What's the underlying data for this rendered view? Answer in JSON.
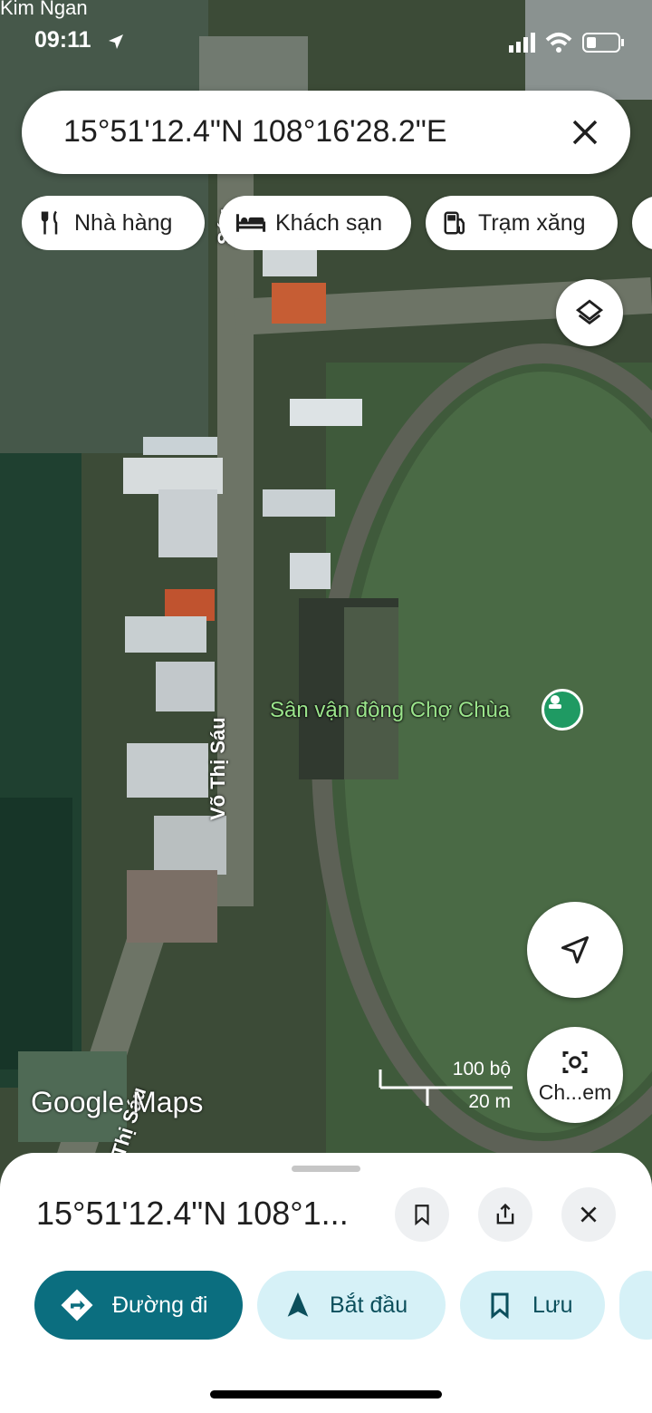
{
  "status_bar": {
    "carrier": "Kim Ngan",
    "time": "09:11"
  },
  "search": {
    "query": "15°51'12.4\"N 108°16'28.2\"E"
  },
  "chips": [
    {
      "label": "Nhà hàng",
      "icon": "restaurant-icon"
    },
    {
      "label": "Khách sạn",
      "icon": "hotel-icon"
    },
    {
      "label": "Trạm xăng",
      "icon": "gas-station-icon"
    }
  ],
  "map": {
    "poi_label": "Sân vận động Chợ Chùa",
    "street_label_1": "Võ Thị Sáu",
    "street_label_2": "Thị Sáu",
    "street_label_3": "Sáu",
    "logo": "Google Maps",
    "scale_top": "100 bộ",
    "scale_bottom": "20 m",
    "lens_label": "Ch...em"
  },
  "sheet": {
    "title": "15°51'12.4\"N 108°1...",
    "actions": [
      {
        "label": "Đường đi",
        "icon": "directions-icon"
      },
      {
        "label": "Bắt đầu",
        "icon": "navigation-icon"
      },
      {
        "label": "Lưu",
        "icon": "bookmark-icon"
      }
    ]
  },
  "colors": {
    "accent": "#0b6e7f",
    "chip_light": "#d6f1f7",
    "poi_green": "#9be58c"
  }
}
